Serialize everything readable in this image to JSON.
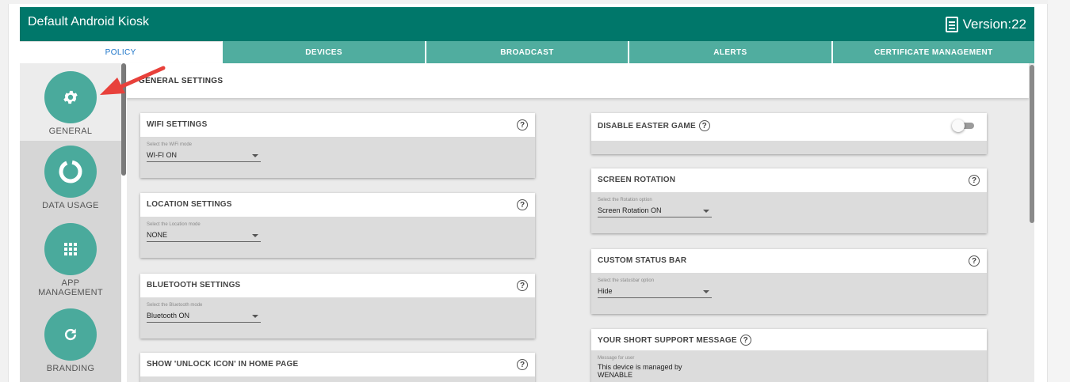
{
  "header": {
    "title": "Default Android Kiosk",
    "version": "Version:22"
  },
  "tabs": [
    {
      "label": "POLICY",
      "active": true
    },
    {
      "label": "DEVICES"
    },
    {
      "label": "BROADCAST"
    },
    {
      "label": "ALERTS"
    },
    {
      "label": "CERTIFICATE MANAGEMENT"
    }
  ],
  "sidebar": {
    "items": [
      {
        "label": "GENERAL",
        "icon": "gear-icon"
      },
      {
        "label": "DATA USAGE",
        "icon": "donut-icon"
      },
      {
        "label": "APP\nMANAGEMENT",
        "icon": "grid-icon"
      },
      {
        "label": "BRANDING",
        "icon": "refresh-icon"
      }
    ]
  },
  "content": {
    "title": "GENERAL SETTINGS",
    "help": "?",
    "wifi": {
      "title": "WIFI SETTINGS",
      "label": "Select the WiFi mode",
      "value": "WI-FI ON"
    },
    "location": {
      "title": "LOCATION SETTINGS",
      "label": "Select the Location mode",
      "value": "NONE"
    },
    "bluetooth": {
      "title": "BLUETOOTH SETTINGS",
      "label": "Select the Bluetooth mode",
      "value": "Bluetooth ON"
    },
    "unlock": {
      "title": "SHOW 'UNLOCK ICON' IN HOME PAGE"
    },
    "easter": {
      "title": "DISABLE EASTER GAME",
      "enabled": false
    },
    "rotation": {
      "title": "SCREEN ROTATION",
      "label": "Select the Rotation option",
      "value": "Screen Rotation ON"
    },
    "statusbar": {
      "title": "CUSTOM STATUS BAR",
      "label": "Select the statusbar option",
      "value": "Hide"
    },
    "support": {
      "title": "YOUR SHORT SUPPORT MESSAGE",
      "label": "Message for user",
      "value": "This device is managed by WENABLE"
    }
  },
  "colors": {
    "header": "#00776a",
    "tab": "#50ad9f",
    "accent": "#4aaa9c",
    "arrow": "#e8413b"
  }
}
